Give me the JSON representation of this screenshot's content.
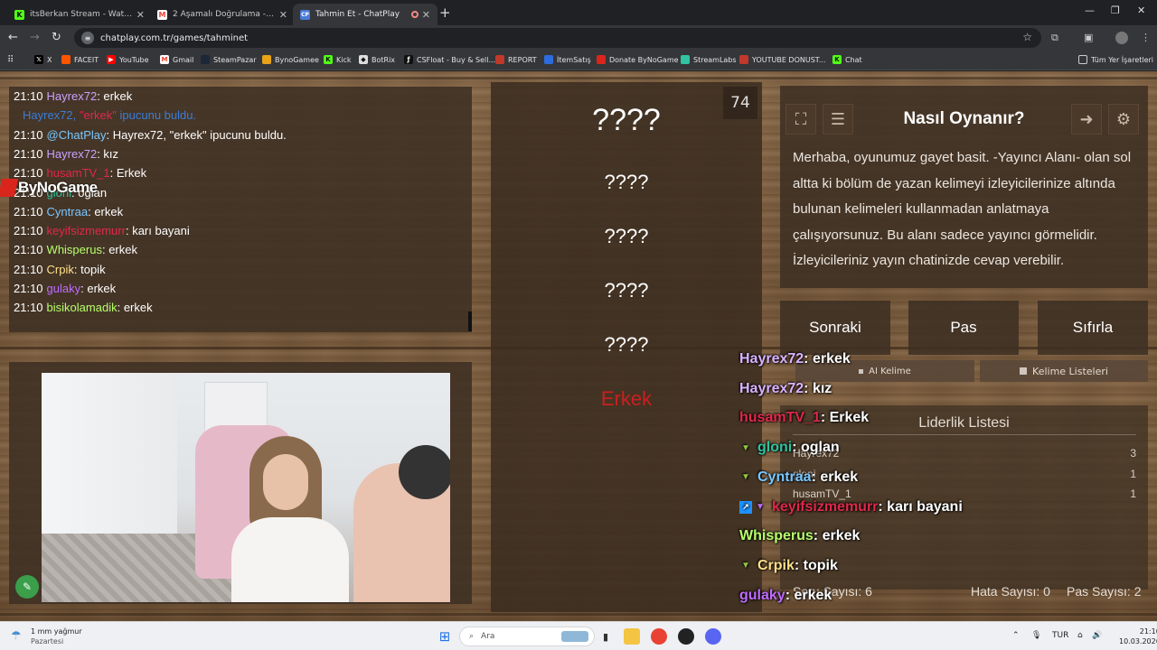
{
  "browser": {
    "tabs": [
      {
        "label": "itsBerkan Stream - Watch Live o",
        "favicon": "K",
        "color": "#53fc18",
        "active": false
      },
      {
        "label": "2 Aşamalı Doğrulama - berkane",
        "favicon": "M",
        "color": "#ea4335",
        "active": false
      },
      {
        "label": "Tahmin Et - ChatPlay",
        "favicon": "CP",
        "color": "#4a7bd6",
        "active": true
      }
    ],
    "url": "chatplay.com.tr/games/tahminet",
    "bookmarks": [
      {
        "label": "X",
        "icon_color": "#000000"
      },
      {
        "label": "FACEIT",
        "icon_color": "#ff5500"
      },
      {
        "label": "YouTube",
        "icon_color": "#ff0000"
      },
      {
        "label": "Gmail",
        "icon_color": "#ea4335"
      },
      {
        "label": "SteamPazar",
        "icon_color": "#1b2838"
      },
      {
        "label": "BynoGamee",
        "icon_color": "#e8a317"
      },
      {
        "label": "Kick",
        "icon_color": "#53fc18"
      },
      {
        "label": "BotRix",
        "icon_color": "#ffffff"
      },
      {
        "label": "CSFloat - Buy & Sell...",
        "icon_color": "#111111"
      },
      {
        "label": "REPORT",
        "icon_color": "#c0392b"
      },
      {
        "label": "İtemSatış",
        "icon_color": "#2d6cdf"
      },
      {
        "label": "Donate ByNoGame",
        "icon_color": "#d9251c"
      },
      {
        "label": "StreamLabs",
        "icon_color": "#31c3a2"
      },
      {
        "label": "YOUTUBE DONUST...",
        "icon_color": "#c0392b"
      },
      {
        "label": "Chat",
        "icon_color": "#53fc18"
      }
    ],
    "all_bookmarks_label": "Tüm Yer İşaretleri"
  },
  "chat": [
    {
      "time": "21:10",
      "user": "Hayrex72",
      "user_color": "#c8a2ff",
      "sep": ": ",
      "msg": "erkek",
      "msg_color": "#ffffff"
    },
    {
      "time": "",
      "user": "Hayrex72, ",
      "user_color": "#3b7dd8",
      "sep": "",
      "msg": "\"erkek\" ipucunu buldu.",
      "msg_color": "#3b7dd8",
      "hl": "\"erkek\""
    },
    {
      "time": "21:10",
      "user": "@ChatPlay",
      "user_color": "#79c7ff",
      "sep": ": ",
      "msg": "Hayrex72, \"erkek\" ipucunu buldu.",
      "msg_color": "#ffffff"
    },
    {
      "time": "21:10",
      "user": "Hayrex72",
      "user_color": "#c8a2ff",
      "sep": ": ",
      "msg": "kız",
      "msg_color": "#ffffff"
    },
    {
      "time": "21:10",
      "user": "husamTV_1",
      "user_color": "#e0284a",
      "sep": ": ",
      "msg": "Erkek",
      "msg_color": "#ffffff"
    },
    {
      "time": "21:10",
      "user": "gloni",
      "user_color": "#2ec4a0",
      "sep": ": ",
      "msg": "oglan",
      "msg_color": "#ffffff"
    },
    {
      "time": "21:10",
      "user": "Cyntraa",
      "user_color": "#79c7ff",
      "sep": ": ",
      "msg": "erkek",
      "msg_color": "#ffffff"
    },
    {
      "time": "21:10",
      "user": "keyifsizmemurr",
      "user_color": "#e0284a",
      "sep": ": ",
      "msg": "karı bayani",
      "msg_color": "#ffffff"
    },
    {
      "time": "21:10",
      "user": "Whisperus",
      "user_color": "#b6ff6b",
      "sep": ": ",
      "msg": "erkek",
      "msg_color": "#ffffff"
    },
    {
      "time": "21:10",
      "user": "Crpik",
      "user_color": "#ffe08a",
      "sep": ": ",
      "msg": "topik",
      "msg_color": "#ffffff"
    },
    {
      "time": "21:10",
      "user": "gulaky",
      "user_color": "#c06bff",
      "sep": ": ",
      "msg": "erkek",
      "msg_color": "#ffffff"
    },
    {
      "time": "21:10",
      "user": "bisikolamadik",
      "user_color": "#b6ff6b",
      "sep": ": ",
      "msg": "erkek",
      "msg_color": "#ffffff"
    }
  ],
  "bynogame_watermark": "ByNoGame",
  "game": {
    "counter": "74",
    "main_word": "????",
    "hidden_words": [
      "????",
      "????",
      "????",
      "????"
    ],
    "found_word": "Erkek",
    "how_to_title": "Nasıl Oynanır?",
    "how_to_text": "Merhaba, oyunumuz gayet basit. -Yayıncı Alanı- olan sol altta ki bölüm de yazan kelimeyi izleyicilerinize altında bulunan kelimeleri kullanmadan anlatmaya çalışıyorsunuz. Bu alanı sadece yayıncı görmelidir. İzleyicileriniz yayın chatinizde cevap verebilir.",
    "buttons": {
      "next": "Sonraki",
      "pass": "Pas",
      "reset": "Sıfırla"
    },
    "ai_word": "AI Kelime",
    "word_lists": "Kelime Listeleri",
    "leaderboard_title": "Liderlik Listesi",
    "leaderboard": [
      {
        "name": "Hayrex72",
        "score": "3"
      },
      {
        "name": "gloni",
        "score": "1"
      },
      {
        "name": "husamTV_1",
        "score": "1"
      }
    ],
    "stats": {
      "questions": "Soru Sayısı: 6",
      "errors": "Hata Sayısı: 0",
      "passes": "Pas Sayısı: 2"
    }
  },
  "overlay_chat": [
    {
      "user": "Hayrex72",
      "color": "#d9b3ff",
      "msg": "erkek",
      "badge": ""
    },
    {
      "user": "Hayrex72",
      "color": "#d9b3ff",
      "msg": "kız",
      "badge": ""
    },
    {
      "user": "husamTV_1",
      "color": "#e0284a",
      "msg": "Erkek",
      "badge": ""
    },
    {
      "user": "gloni",
      "color": "#2ec4a0",
      "msg": "oglan",
      "badge": "heart"
    },
    {
      "user": "Cyntraa",
      "color": "#79c7ff",
      "msg": "erkek",
      "badge": "heart"
    },
    {
      "user": "keyifsizmemurr",
      "color": "#e0284a",
      "msg": "karı bayani",
      "badge": "arrow"
    },
    {
      "user": "Whisperus",
      "color": "#b6ff6b",
      "msg": "erkek",
      "badge": ""
    },
    {
      "user": "Crpik",
      "color": "#ffe08a",
      "msg": "topik",
      "badge": "heart"
    },
    {
      "user": "gulaky",
      "color": "#c06bff",
      "msg": "erkek",
      "badge": ""
    }
  ],
  "taskbar": {
    "weather_temp": "1 mm yağmur",
    "weather_day": "Pazartesi",
    "search": "Ara",
    "lang": "TUR",
    "time": "21:10",
    "date": "10.03.2026"
  }
}
